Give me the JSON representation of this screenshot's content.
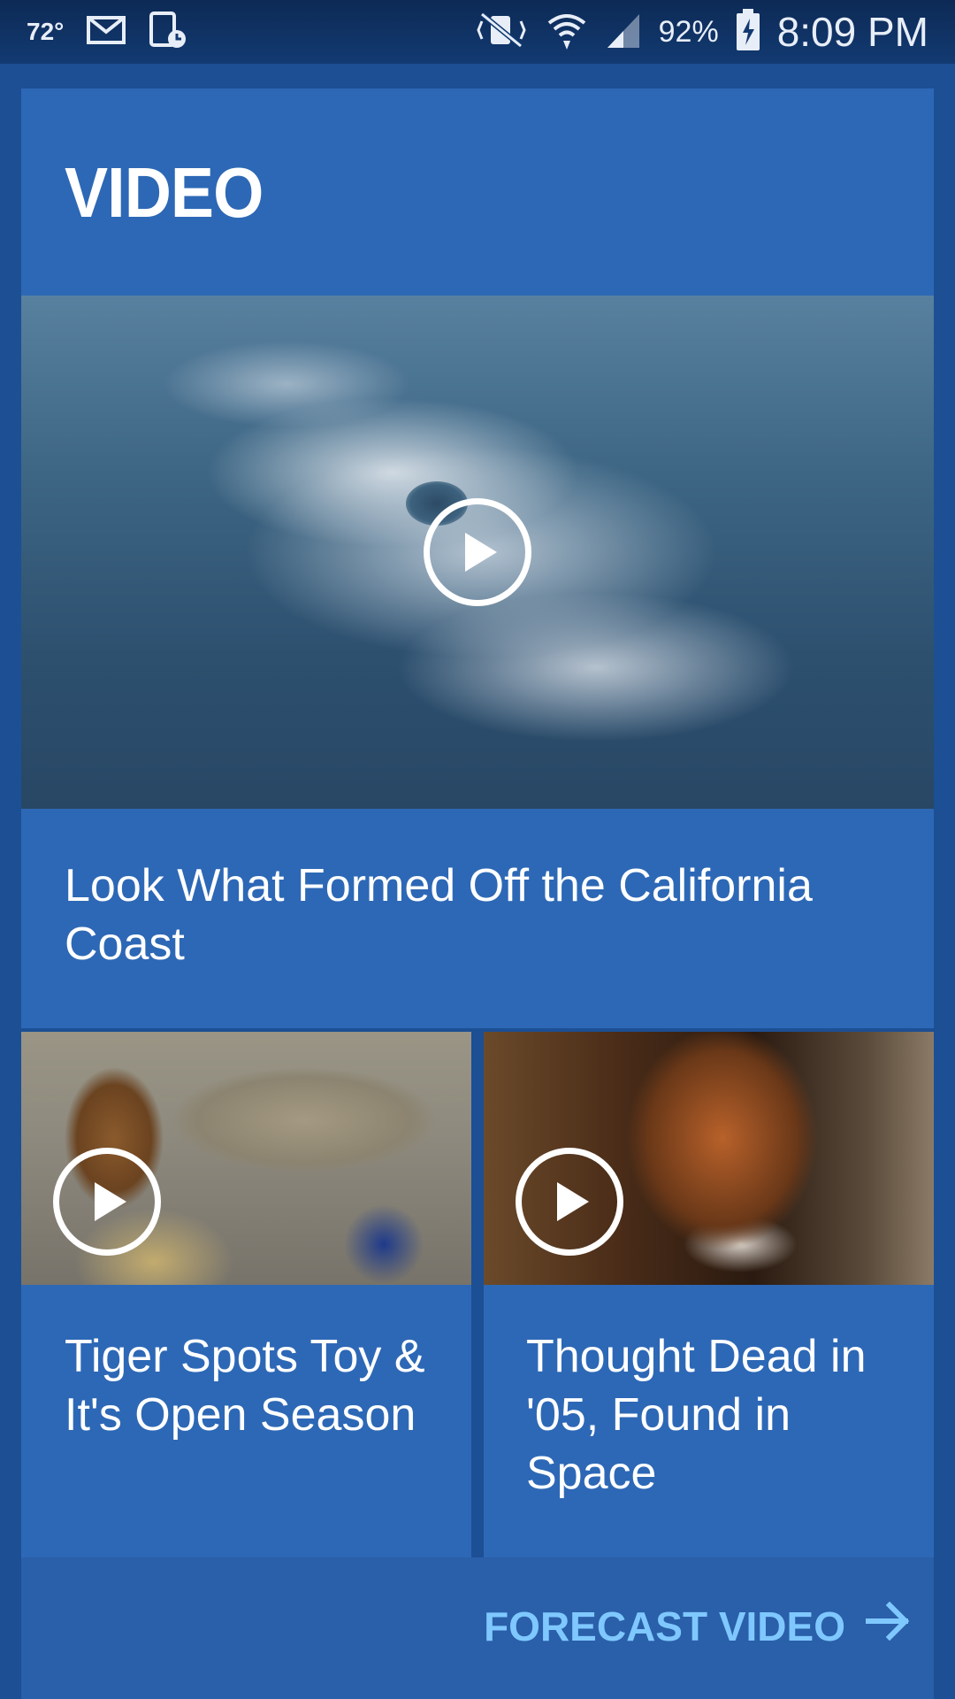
{
  "status_bar": {
    "temperature": "72°",
    "battery": "92%",
    "time": "8:09 PM",
    "icons": [
      "mail-icon",
      "screen-record-icon",
      "vibrate-mute-icon",
      "wifi-icon",
      "signal-icon",
      "battery-charging-icon"
    ]
  },
  "card": {
    "title": "VIDEO",
    "featured": {
      "caption": "Look What Formed Off the California Coast"
    },
    "videos": [
      {
        "caption": "Tiger Spots Toy & It's Open Season"
      },
      {
        "caption": "Thought Dead in '05, Found in Space"
      }
    ],
    "link_label": "FORECAST VIDEO"
  },
  "colors": {
    "card_bg": "#2d68b6",
    "page_bg": "#1c4f94",
    "link": "#7fc8ff"
  }
}
